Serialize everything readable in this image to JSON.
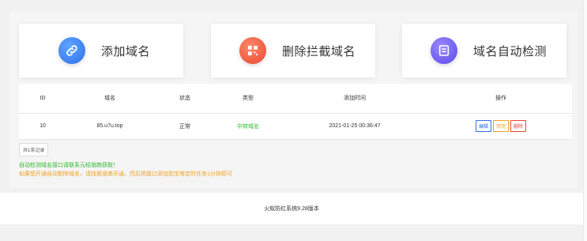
{
  "cards": {
    "add": {
      "label": "添加域名",
      "icon": "link-icon"
    },
    "delete": {
      "label": "删除拦截域名",
      "icon": "qrcode-icon"
    },
    "detect": {
      "label": "域名自动检测",
      "icon": "list-icon"
    }
  },
  "table": {
    "headers": [
      "ID",
      "域名",
      "状态",
      "类型",
      "添加时间",
      "操作"
    ],
    "rows": [
      {
        "id": "10",
        "domain": "85.u7u.top",
        "status": "正常",
        "type": "中转域名",
        "time": "2021-01-25 00:36:47"
      }
    ],
    "actions": {
      "edit": "编辑",
      "disable": "禁用",
      "delete": "删除"
    }
  },
  "count_label": "共1条记录",
  "note_green": "自动检测域名接口请联系元经销商获取！",
  "note_orange": "如果想开通自动剔除域名，请找渠道商开通，然后把接口添加到宝塔定时任务1分钟即可",
  "footer": "火蚁防红系统9.28版本",
  "colors": {
    "green": "#2eb82e",
    "orange": "#f0a020",
    "blue": "#2f6ee8",
    "red": "#e8462f"
  }
}
